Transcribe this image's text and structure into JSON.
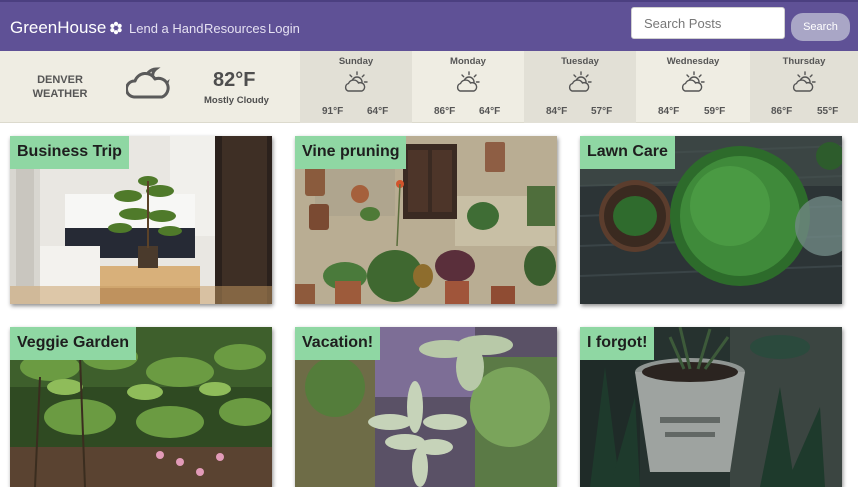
{
  "nav": {
    "brand": "GreenHouse",
    "links": [
      "Lend a Hand",
      "Resources",
      "Login"
    ],
    "search_placeholder": "Search Posts",
    "search_button": "Search"
  },
  "weather": {
    "location": "DENVER WEATHER",
    "current_icon": "partly-cloudy-night-icon",
    "current_temp": "82°F",
    "condition": "Mostly Cloudy",
    "forecast": [
      {
        "day": "Sunday",
        "icon": "partly-sunny-icon",
        "high": "91°F",
        "low": "64°F"
      },
      {
        "day": "Monday",
        "icon": "partly-sunny-icon",
        "high": "86°F",
        "low": "64°F"
      },
      {
        "day": "Tuesday",
        "icon": "partly-sunny-icon",
        "high": "84°F",
        "low": "57°F"
      },
      {
        "day": "Wednesday",
        "icon": "partly-sunny-icon",
        "high": "84°F",
        "low": "59°F"
      },
      {
        "day": "Thursday",
        "icon": "partly-sunny-icon",
        "high": "86°F",
        "low": "55°F"
      }
    ]
  },
  "posts": [
    {
      "title": "Business Trip"
    },
    {
      "title": "Vine pruning"
    },
    {
      "title": "Lawn Care"
    },
    {
      "title": "Veggie Garden"
    },
    {
      "title": "Vacation!"
    },
    {
      "title": "I forgot!"
    }
  ],
  "colors": {
    "navbar": "#5f5196",
    "weather_bar": "#efede3",
    "card_label": "#8fd7a3",
    "search_button": "#a9a6c6"
  }
}
